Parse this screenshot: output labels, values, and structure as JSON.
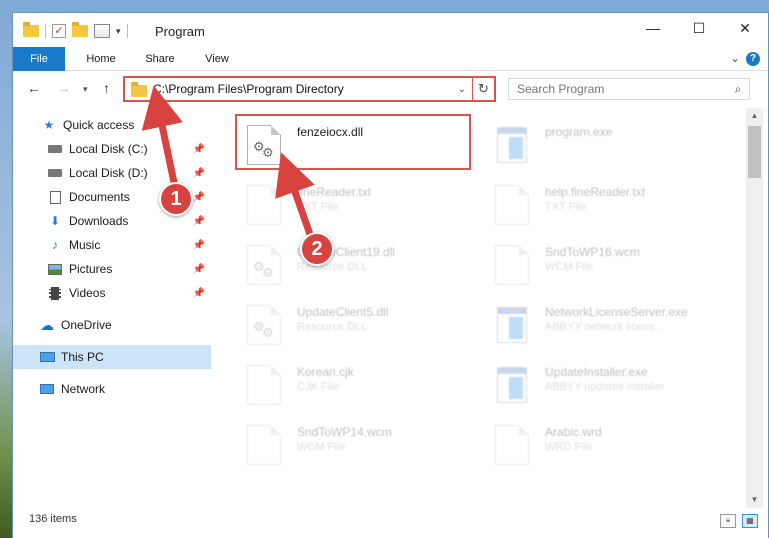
{
  "window": {
    "title": "Program",
    "controls": {
      "minimize": "—",
      "maximize": "☐",
      "close": "✕"
    }
  },
  "ribbon": {
    "tabs": [
      "File",
      "Home",
      "Share",
      "View"
    ]
  },
  "address": {
    "path": "C:\\Program Files\\Program Directory",
    "search_placeholder": "Search Program"
  },
  "sidebar": {
    "items": [
      {
        "label": "Quick access",
        "icon": "star-icon"
      },
      {
        "label": "Local Disk (C:)",
        "icon": "drive-icon",
        "pinned": true
      },
      {
        "label": "Local Disk (D:)",
        "icon": "drive-icon",
        "pinned": true
      },
      {
        "label": "Documents",
        "icon": "documents-icon",
        "pinned": true
      },
      {
        "label": "Downloads",
        "icon": "download-icon",
        "pinned": true
      },
      {
        "label": "Music",
        "icon": "music-icon",
        "pinned": true
      },
      {
        "label": "Pictures",
        "icon": "pictures-icon",
        "pinned": true
      },
      {
        "label": "Videos",
        "icon": "videos-icon",
        "pinned": true
      },
      {
        "label": "OneDrive",
        "icon": "cloud-icon"
      },
      {
        "label": "This PC",
        "icon": "computer-icon",
        "selected": true
      },
      {
        "label": "Network",
        "icon": "network-icon"
      }
    ]
  },
  "files": [
    {
      "name": "fenzeiocx.dll",
      "type": "",
      "kind": "dll",
      "faded": false
    },
    {
      "name": "program.exe",
      "type": "",
      "kind": "exe",
      "faded": true
    },
    {
      "name": "fineReader.txt",
      "type": "TXT File",
      "kind": "doc",
      "faded": true
    },
    {
      "name": "help.fineReader.txt",
      "type": "TXT File",
      "kind": "doc",
      "faded": true
    },
    {
      "name": "UpdateClient19.dll",
      "type": "Resource DLL",
      "kind": "dll",
      "faded": true
    },
    {
      "name": "SndToWP16.wcm",
      "type": "WCM File",
      "kind": "doc",
      "faded": true
    },
    {
      "name": "UpdateClient5.dll",
      "type": "Resource DLL",
      "kind": "dll",
      "faded": true
    },
    {
      "name": "NetworkLicenseServer.exe",
      "type": "ABBYY network licens...",
      "kind": "exe",
      "faded": true
    },
    {
      "name": "Korean.cjk",
      "type": "CJK File",
      "kind": "doc",
      "faded": true
    },
    {
      "name": "UpdateInstaller.exe",
      "type": "ABBYY updates installer",
      "kind": "exe",
      "faded": true
    },
    {
      "name": "SndToWP14.wcm",
      "type": "WCM File",
      "kind": "doc",
      "faded": true
    },
    {
      "name": "Arabic.wrd",
      "type": "WRD File",
      "kind": "doc",
      "faded": true
    }
  ],
  "status": {
    "count": "136 items"
  },
  "annotations": {
    "step1": "1",
    "step2": "2"
  },
  "colors": {
    "accent": "#1979ca",
    "highlight": "#d9534f",
    "selected": "#cce4f7"
  }
}
